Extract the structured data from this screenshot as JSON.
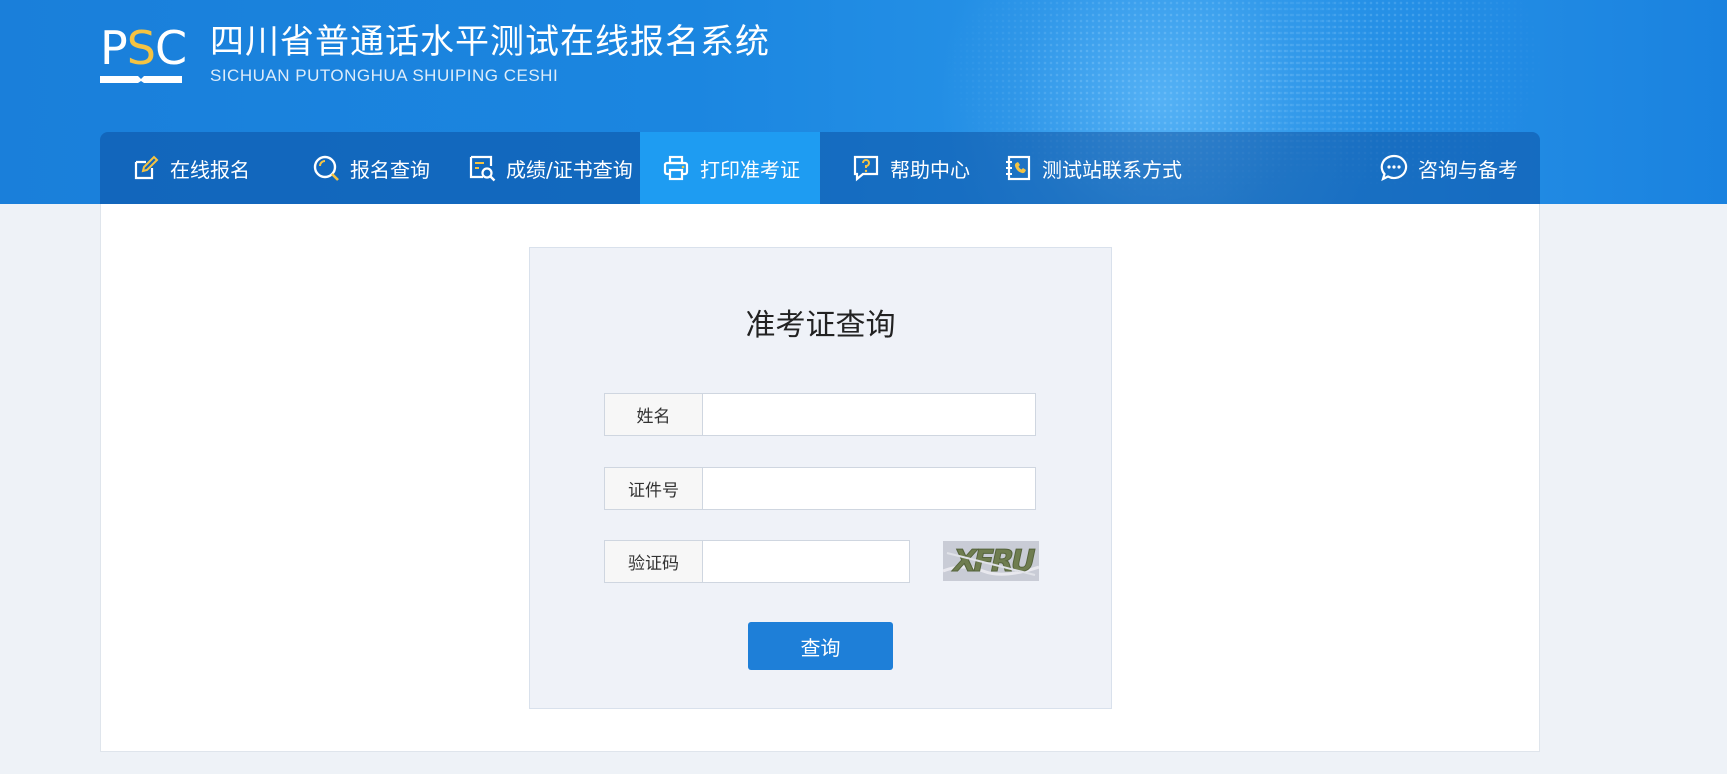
{
  "header": {
    "logo": {
      "letters_p": "P",
      "letters_s": "S",
      "letters_c": "C"
    },
    "title": "四川省普通话水平测试在线报名系统",
    "subtitle": "SICHUAN PUTONGHUA SHUIPING CESHI"
  },
  "nav": {
    "items": [
      {
        "label": "在线报名",
        "icon": "edit-icon",
        "active": false
      },
      {
        "label": "报名查询",
        "icon": "search-icon",
        "active": false
      },
      {
        "label": "成绩/证书查询",
        "icon": "certificate-search-icon",
        "active": false
      },
      {
        "label": "打印准考证",
        "icon": "printer-icon",
        "active": true
      },
      {
        "label": "帮助中心",
        "icon": "help-icon",
        "active": false
      },
      {
        "label": "测试站联系方式",
        "icon": "contact-book-icon",
        "active": false
      },
      {
        "label": "咨询与备考",
        "icon": "chat-icon",
        "active": false
      }
    ]
  },
  "form": {
    "title": "准考证查询",
    "fields": {
      "name": {
        "label": "姓名",
        "value": "",
        "placeholder": ""
      },
      "id_number": {
        "label": "证件号",
        "value": "",
        "placeholder": ""
      },
      "captcha": {
        "label": "验证码",
        "value": "",
        "placeholder": "",
        "image_text": "XFRU"
      }
    },
    "submit_label": "查询"
  },
  "colors": {
    "banner": "#1a82df",
    "nav_active": "#1e9cf2",
    "button": "#1e7fd8",
    "logo_accent": "#f5c342"
  }
}
